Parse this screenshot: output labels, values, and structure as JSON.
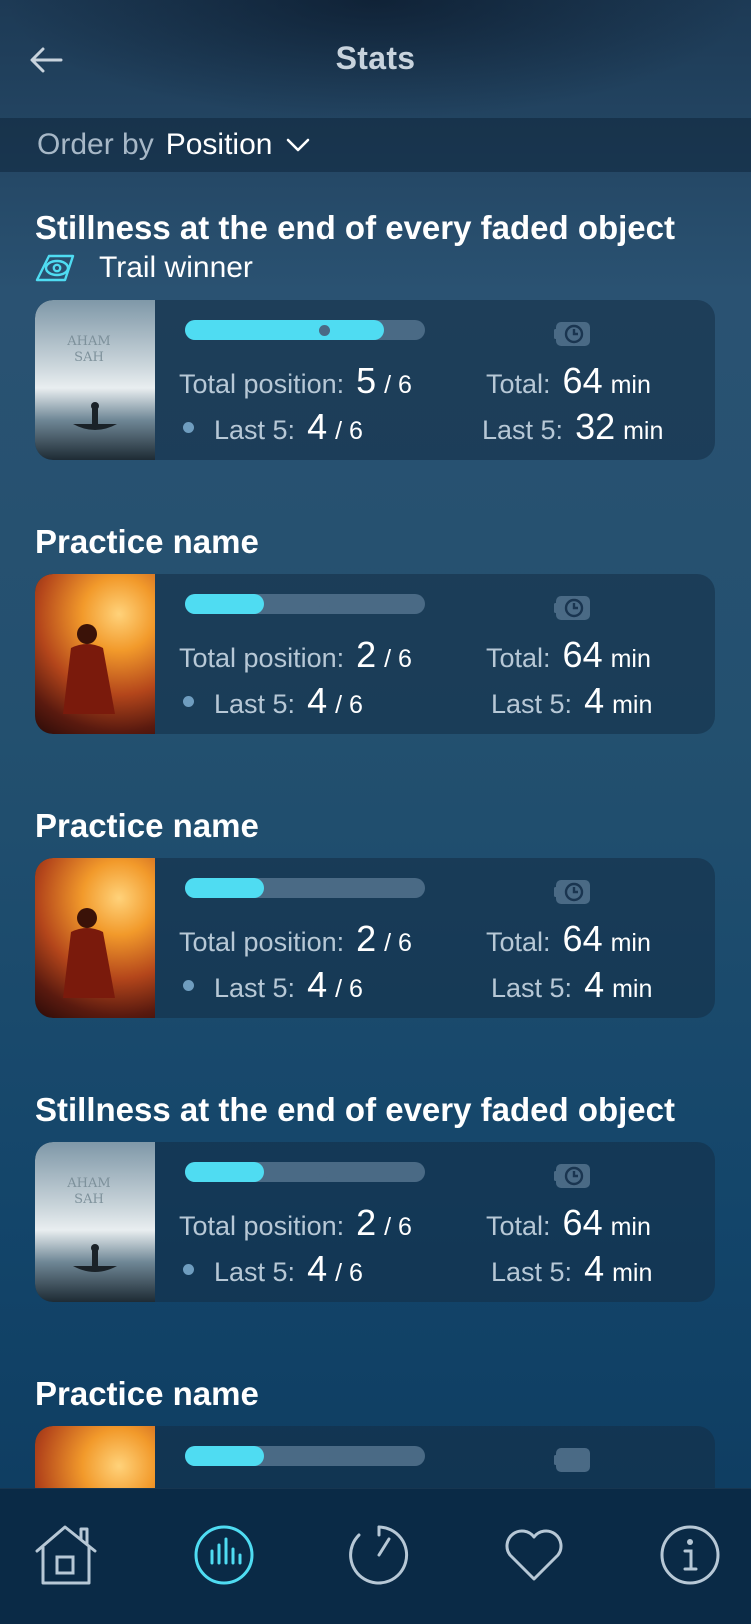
{
  "header": {
    "title": "Stats"
  },
  "order": {
    "label": "Order by",
    "value": "Position"
  },
  "items": [
    {
      "title": "Stillness at the end of every faded object",
      "badge": "Trail winner",
      "thumb_text": "AHAM SAH",
      "progress": 0.83,
      "total_position_label": "Total position:",
      "total_position_value": "5",
      "total_position_of": "/ 6",
      "last5_label": "Last 5:",
      "last5_value": "4",
      "last5_of": "/ 6",
      "total_time_label": "Total:",
      "total_time_value": "64",
      "total_time_unit": "min",
      "last5_time_label": "Last 5:",
      "last5_time_value": "32",
      "last5_time_unit": "min"
    },
    {
      "title": "Practice name",
      "progress": 0.33,
      "total_position_label": "Total position:",
      "total_position_value": "2",
      "total_position_of": "/ 6",
      "last5_label": "Last 5:",
      "last5_value": "4",
      "last5_of": "/ 6",
      "total_time_label": "Total:",
      "total_time_value": "64",
      "total_time_unit": "min",
      "last5_time_label": "Last 5:",
      "last5_time_value": "4",
      "last5_time_unit": "min"
    },
    {
      "title": "Practice name",
      "progress": 0.33,
      "total_position_label": "Total position:",
      "total_position_value": "2",
      "total_position_of": "/ 6",
      "last5_label": "Last 5:",
      "last5_value": "4",
      "last5_of": "/ 6",
      "total_time_label": "Total:",
      "total_time_value": "64",
      "total_time_unit": "min",
      "last5_time_label": "Last 5:",
      "last5_time_value": "4",
      "last5_time_unit": "min"
    },
    {
      "title": "Stillness at the end of every faded object",
      "thumb_text": "AHAM SAH",
      "progress": 0.33,
      "total_position_label": "Total position:",
      "total_position_value": "2",
      "total_position_of": "/ 6",
      "last5_label": "Last 5:",
      "last5_value": "4",
      "last5_of": "/ 6",
      "total_time_label": "Total:",
      "total_time_value": "64",
      "total_time_unit": "min",
      "last5_time_label": "Last 5:",
      "last5_time_value": "4",
      "last5_time_unit": "min"
    },
    {
      "title": "Practice name",
      "progress": 0.33
    }
  ],
  "nav": [
    {
      "icon": "home-icon",
      "active": false
    },
    {
      "icon": "stats-icon",
      "active": true
    },
    {
      "icon": "timer-icon",
      "active": false
    },
    {
      "icon": "heart-icon",
      "active": false
    },
    {
      "icon": "info-icon",
      "active": false
    }
  ],
  "colors": {
    "accent": "#4fdcf2",
    "track": "#4a6a85",
    "nav_bg": "#0a2a46"
  }
}
